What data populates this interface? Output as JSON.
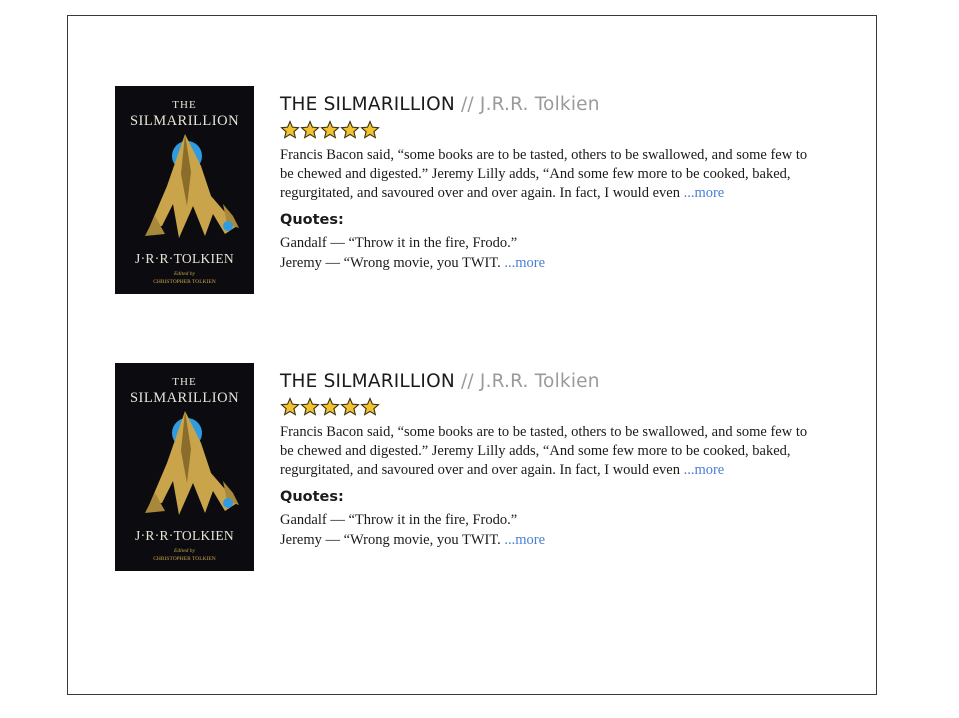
{
  "books": [
    {
      "cover": {
        "title_line1": "THE",
        "title_line2": "SILMARILLION",
        "author": "J·R·R·TOLKIEN",
        "edited_by": "Edited by",
        "editor": "CHRISTOPHER TOLKIEN"
      },
      "title": "THE SILMARILLION",
      "separator": " // ",
      "author": "J.R.R. Tolkien",
      "rating": 5,
      "description": "Francis Bacon said, “some books are to be tasted, others to be swallowed, and some few to be chewed and digested.” Jeremy Lilly adds, “And some few more to be cooked, baked, regurgitated, and savoured over and over again. In fact, I would even ",
      "more_label": "...more",
      "quotes_heading": "Quotes:",
      "quotes": [
        "Gandalf — “Throw it in the fire, Frodo.”",
        "Jeremy — “Wrong movie, you TWIT. "
      ],
      "quotes_more_label": "...more"
    },
    {
      "cover": {
        "title_line1": "THE",
        "title_line2": "SILMARILLION",
        "author": "J·R·R·TOLKIEN",
        "edited_by": "Edited by",
        "editor": "CHRISTOPHER TOLKIEN"
      },
      "title": "THE SILMARILLION",
      "separator": " // ",
      "author": "J.R.R. Tolkien",
      "rating": 5,
      "description": "Francis Bacon said, “some books are to be tasted, others to be swallowed, and some few to be chewed and digested.” Jeremy Lilly adds, “And some few more to be cooked, baked, regurgitated, and savoured over and over again. In fact, I would even ",
      "more_label": "...more",
      "quotes_heading": "Quotes:",
      "quotes": [
        "Gandalf — “Throw it in the fire, Frodo.”",
        "Jeremy — “Wrong movie, you TWIT. "
      ],
      "quotes_more_label": "...more"
    }
  ],
  "colors": {
    "link": "#4a7fd6",
    "star_fill": "#f2c230",
    "star_stroke": "#3a3010",
    "cover_bg": "#0c0c10",
    "cover_moon": "#2f9be0",
    "cover_gold": "#c9a44a"
  }
}
